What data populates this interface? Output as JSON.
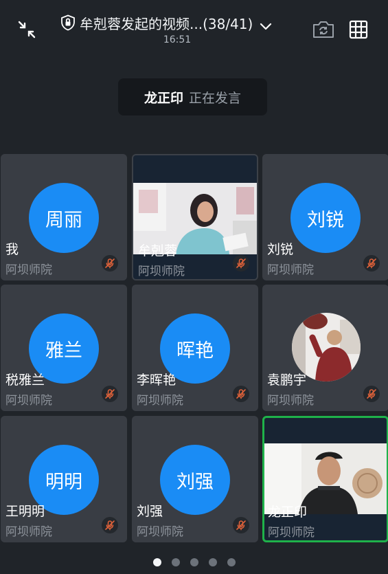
{
  "header": {
    "title": "牟剋蓉发起的视频...(38/41)",
    "time": "16:51"
  },
  "speaking": {
    "name": "龙正印",
    "status": "正在发言"
  },
  "tiles": [
    {
      "avatar_text": "周丽",
      "name": "我",
      "org": "阿坝师院",
      "type": "avatar"
    },
    {
      "name": "牟剋蓉",
      "org": "阿坝师院",
      "type": "video"
    },
    {
      "avatar_text": "刘锐",
      "name": "刘锐",
      "org": "阿坝师院",
      "type": "avatar"
    },
    {
      "avatar_text": "雅兰",
      "name": "税雅兰",
      "org": "阿坝师院",
      "type": "avatar"
    },
    {
      "avatar_text": "晖艳",
      "name": "李晖艳",
      "org": "阿坝师院",
      "type": "avatar"
    },
    {
      "name": "袁鹏宇",
      "org": "阿坝师院",
      "type": "photo"
    },
    {
      "avatar_text": "明明",
      "name": "王明明",
      "org": "阿坝师院",
      "type": "avatar"
    },
    {
      "avatar_text": "刘强",
      "name": "刘强",
      "org": "阿坝师院",
      "type": "avatar"
    },
    {
      "name": "龙正印",
      "org": "阿坝师院",
      "type": "video",
      "active": true
    }
  ],
  "pager": {
    "pages": 5,
    "current": 1
  },
  "colors": {
    "accent": "#1a8cf5",
    "active_border": "#1fb24a",
    "muted_mic": "#e0623a"
  },
  "icons": [
    "collapse-icon",
    "lock-shield-icon",
    "chevron-down-icon",
    "camera-flip-icon",
    "grid-view-icon",
    "mic-muted-icon"
  ]
}
